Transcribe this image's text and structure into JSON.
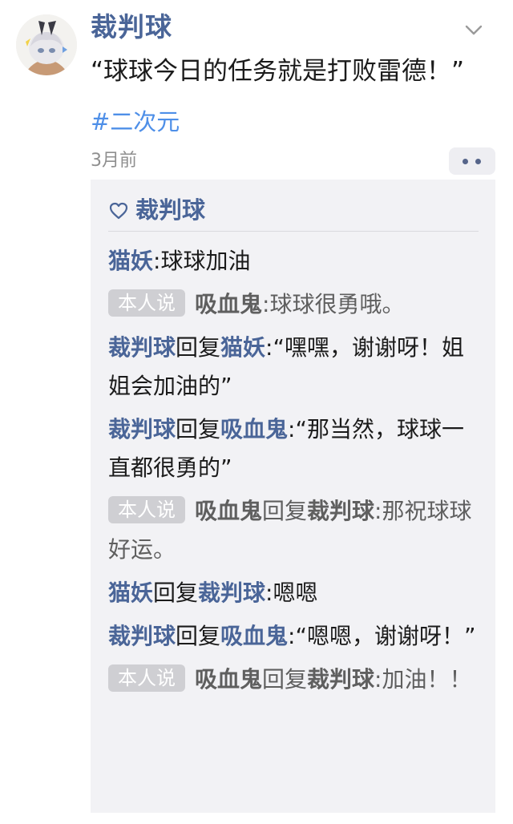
{
  "post": {
    "username": "裁判球",
    "text": "“球球今日的任务就是打败雷德！”",
    "topic": "#二次元",
    "time": "3月前"
  },
  "likes": {
    "names": [
      "裁判球"
    ]
  },
  "comments": [
    {
      "from": "猫妖",
      "sep": ":",
      "text": "球球加油"
    },
    {
      "badge": "本人说",
      "from": "吸血鬼",
      "sep": ":",
      "text": "球球很勇哦。"
    },
    {
      "from": "裁判球",
      "verb": "回复",
      "to": "猫妖",
      "sep": ":",
      "text": "“嘿嘿，谢谢呀！姐姐会加油的”"
    },
    {
      "from": "裁判球",
      "verb": "回复",
      "to": "吸血鬼",
      "sep": ":",
      "text": "“那当然，球球一直都很勇的”"
    },
    {
      "badge": "本人说",
      "from": "吸血鬼",
      "verb": "回复",
      "to": "裁判球",
      "sep": ":",
      "text": "那祝球球好运。"
    },
    {
      "from": "猫妖",
      "verb": "回复",
      "to": "裁判球",
      "sep": ":",
      "text": "嗯嗯"
    },
    {
      "from": "裁判球",
      "verb": "回复",
      "to": "吸血鬼",
      "sep": ":",
      "text": "“嗯嗯，谢谢呀！”"
    },
    {
      "badge": "本人说",
      "from": "吸血鬼",
      "verb": "回复",
      "to": "裁判球",
      "sep": ":",
      "text": "加油！！"
    }
  ],
  "icons": {
    "avatar": "avatar-anime-girl",
    "chevron": "chevron-down-icon",
    "more": "more-dots-icon",
    "like": "heart-icon"
  },
  "colors": {
    "name": "#4a6598",
    "topic": "#4e8fe8",
    "panel": "#f2f2f5",
    "badge": "#cfcfd3"
  }
}
